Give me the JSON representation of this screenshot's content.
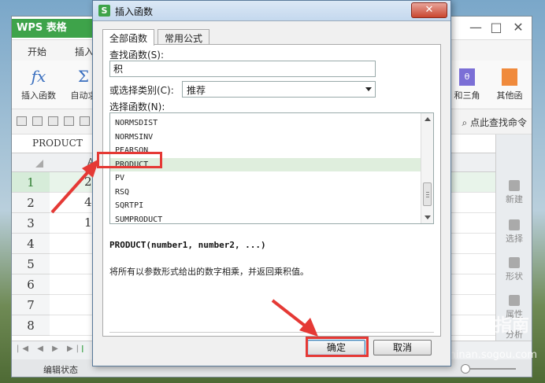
{
  "app": {
    "logo": "WPS 表格",
    "ribbon_tabs": [
      "开始",
      "插入"
    ],
    "ribbon_buttons": [
      "插入函数",
      "自动求",
      "和三角",
      "其他函"
    ],
    "search_command": "点此查找命令",
    "name_box": "PRODUCT",
    "column_letter": "A",
    "rows": [
      {
        "num": "1",
        "value": "2"
      },
      {
        "num": "2",
        "value": "4"
      },
      {
        "num": "3",
        "value": "1"
      },
      {
        "num": "4",
        "value": ""
      },
      {
        "num": "5",
        "value": ""
      },
      {
        "num": "6",
        "value": ""
      },
      {
        "num": "7",
        "value": ""
      },
      {
        "num": "8",
        "value": ""
      }
    ],
    "right_panel": [
      "新建",
      "选择",
      "形状",
      "属性",
      "分析"
    ],
    "sheet_tab": "I",
    "status": "编辑状态",
    "watermark": "搜狗指南",
    "watermark_url": "zhinan.sogou.com"
  },
  "dialog": {
    "title": "插入函数",
    "close_label": "✕",
    "tabs": [
      "全部函数",
      "常用公式"
    ],
    "search_label": "查找函数(S):",
    "search_value": "积",
    "category_label": "或选择类别(C):",
    "category_value": "推荐",
    "list_label": "选择函数(N):",
    "functions": [
      "NORMSDIST",
      "NORMSINV",
      "PEARSON",
      "PRODUCT",
      "PV",
      "RSQ",
      "SQRTPI",
      "SUMPRODUCT"
    ],
    "selected_function": "PRODUCT",
    "signature": "PRODUCT(number1, number2, ...)",
    "description": "将所有以参数形式给出的数字相乘，并返回乘积值。",
    "ok_label": "确定",
    "cancel_label": "取消"
  },
  "colors": {
    "wps_green": "#3ea34a",
    "highlight_red": "#e53935",
    "selection_green": "#dfeedd"
  }
}
